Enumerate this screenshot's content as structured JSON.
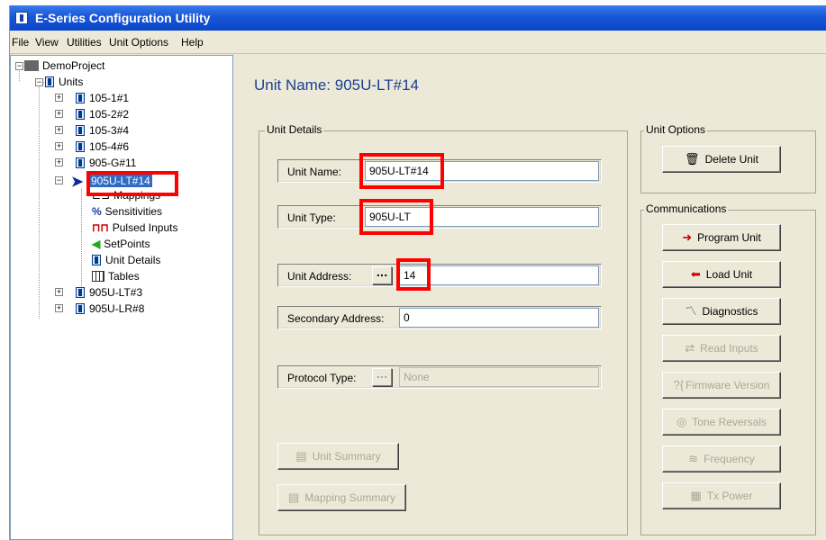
{
  "window": {
    "title": "E-Series Configuration Utility"
  },
  "menu": [
    "File",
    "View",
    "Utilities",
    "Unit Options",
    "Help"
  ],
  "tree": {
    "project": "DemoProject",
    "units_label": "Units",
    "units": [
      "105-1#1",
      "105-2#2",
      "105-3#4",
      "105-4#6",
      "905-G#11"
    ],
    "selected_unit": "905U-LT#14",
    "children": [
      "Mappings",
      "Sensitivities",
      "Pulsed Inputs",
      "SetPoints",
      "Unit Details",
      "Tables"
    ],
    "more_units": [
      "905U-LT#3",
      "905U-LR#8"
    ]
  },
  "main": {
    "title": "Unit Name: 905U-LT#14",
    "unit_details_group": "Unit Details",
    "unit_name_label": "Unit Name:",
    "unit_name_value": "905U-LT#14",
    "unit_type_label": "Unit Type:",
    "unit_type_value": "905U-LT",
    "unit_address_label": "Unit Address:",
    "unit_address_value": "14",
    "secondary_address_label": "Secondary Address:",
    "secondary_address_value": "0",
    "protocol_type_label": "Protocol Type:",
    "protocol_type_value": "None",
    "dots_label": "...",
    "unit_summary_label": "Unit Summary",
    "mapping_summary_label": "Mapping Summary"
  },
  "unit_options": {
    "group": "Unit Options",
    "delete_label": "Delete Unit"
  },
  "communications": {
    "group": "Communications",
    "program_label": "Program Unit",
    "load_label": "Load Unit",
    "diagnostics_label": "Diagnostics",
    "read_inputs_label": "Read Inputs",
    "firmware_label": "Firmware Version",
    "tone_label": "Tone Reversals",
    "frequency_label": "Frequency",
    "tx_power_label": "Tx Power"
  },
  "colors": {
    "highlight": "#ff0000",
    "title_blue": "#1c3f94",
    "selection": "#316ac5"
  }
}
